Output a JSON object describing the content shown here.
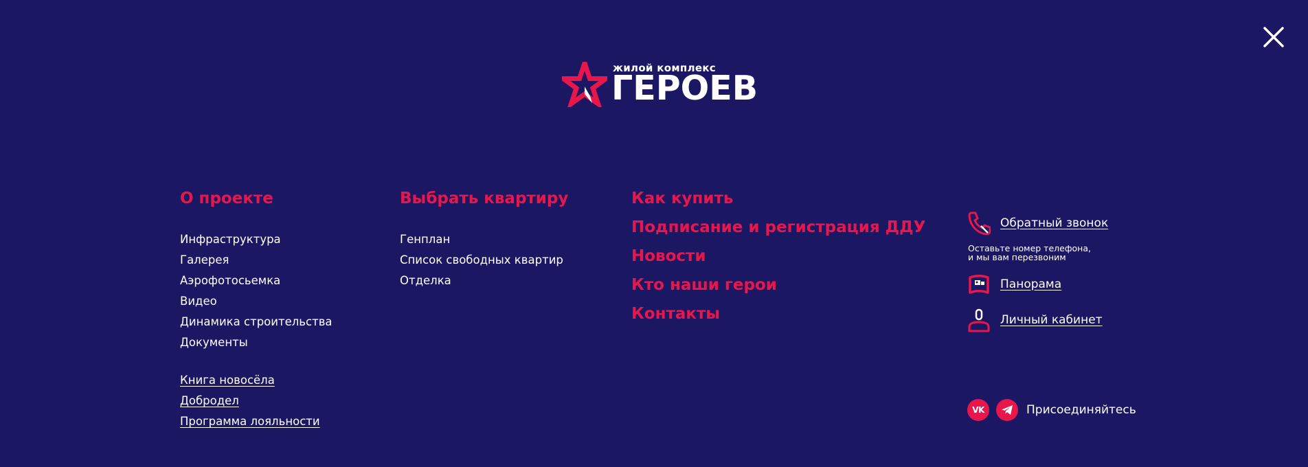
{
  "colors": {
    "background": "#1c1763",
    "accent": "#e8174b",
    "text": "#ffffff"
  },
  "logo": {
    "small_text": "жилой комплекс",
    "big_text": "ГЕРОЕВ"
  },
  "close": {
    "icon": "close-icon"
  },
  "column1": {
    "heading": "О проекте",
    "items": [
      "Инфраструктура",
      "Галерея",
      "Аэрофотосьемка",
      "Видео",
      "Динамика строительства",
      "Документы"
    ],
    "extra_links": [
      "Книга новосёла",
      "Добродел",
      "Программа лояльности"
    ]
  },
  "column2": {
    "heading": "Выбрать квартиру",
    "items": [
      "Генплан",
      "Список свободных квартир",
      "Отделка"
    ]
  },
  "column3": {
    "items": [
      "Как купить",
      "Подписание и регистрация ДДУ",
      "Новости",
      "Кто наши герои",
      "Контакты"
    ]
  },
  "aside": {
    "callback": {
      "label": "Обратный звонок",
      "icon": "phone-icon"
    },
    "callback_note_line1": "Оставьте номер телефона,",
    "callback_note_line2": "и мы вам перезвоним",
    "panorama": {
      "label": "Панорама",
      "icon": "panorama-icon"
    },
    "cabinet": {
      "label": "Личный кабинет",
      "icon": "user-icon"
    }
  },
  "social": {
    "label": "Присоединяйтесь",
    "items": [
      {
        "icon": "vk-icon",
        "text": "vk"
      },
      {
        "icon": "telegram-icon"
      }
    ]
  }
}
